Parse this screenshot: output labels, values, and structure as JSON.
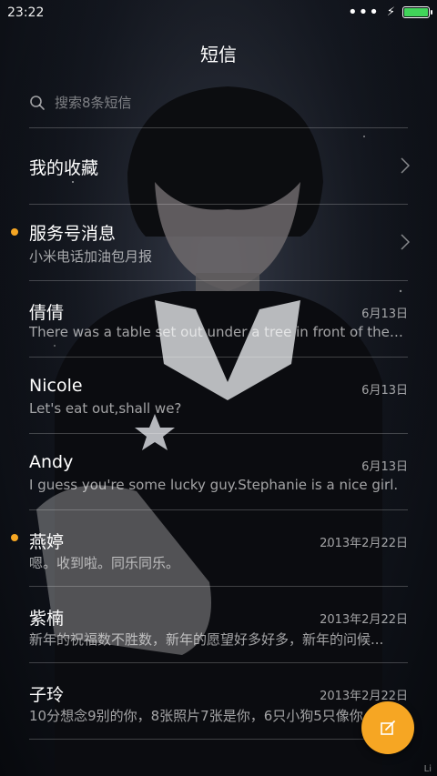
{
  "status_bar": {
    "time": "23:22",
    "battery_level": 1.0,
    "battery_color": "#41d45a"
  },
  "header": {
    "title": "短信"
  },
  "search": {
    "placeholder": "搜索8条短信"
  },
  "favorites": {
    "label": "我的收藏"
  },
  "service": {
    "title": "服务号消息",
    "preview": "小米电话加油包月报",
    "unread": true
  },
  "threads": [
    {
      "name": "倩倩",
      "preview": "There was a table set out under a tree in front of the ho...",
      "date": "6月13日",
      "unread": false
    },
    {
      "name": "Nicole",
      "preview": "Let's eat out,shall we?",
      "date": "6月13日",
      "unread": false
    },
    {
      "name": "Andy",
      "preview": "I guess you're some lucky guy.Stephanie is a nice girl.",
      "date": "6月13日",
      "unread": false
    },
    {
      "name": "燕婷",
      "preview": "嗯。收到啦。同乐同乐。",
      "date": "2013年2月22日",
      "unread": true
    },
    {
      "name": "紫楠",
      "preview": "新年的祝福数不胜数，新年的愿望好多好多，新年的问候...",
      "date": "2013年2月22日",
      "unread": false
    },
    {
      "name": "子玲",
      "preview": "10分想念9别的你，8张照片7张是你，6只小狗5只像你",
      "date": "2013年2月22日",
      "unread": false
    }
  ],
  "compose_icon": "compose-icon",
  "accent_color": "#f6a623",
  "corner_text": "Li"
}
